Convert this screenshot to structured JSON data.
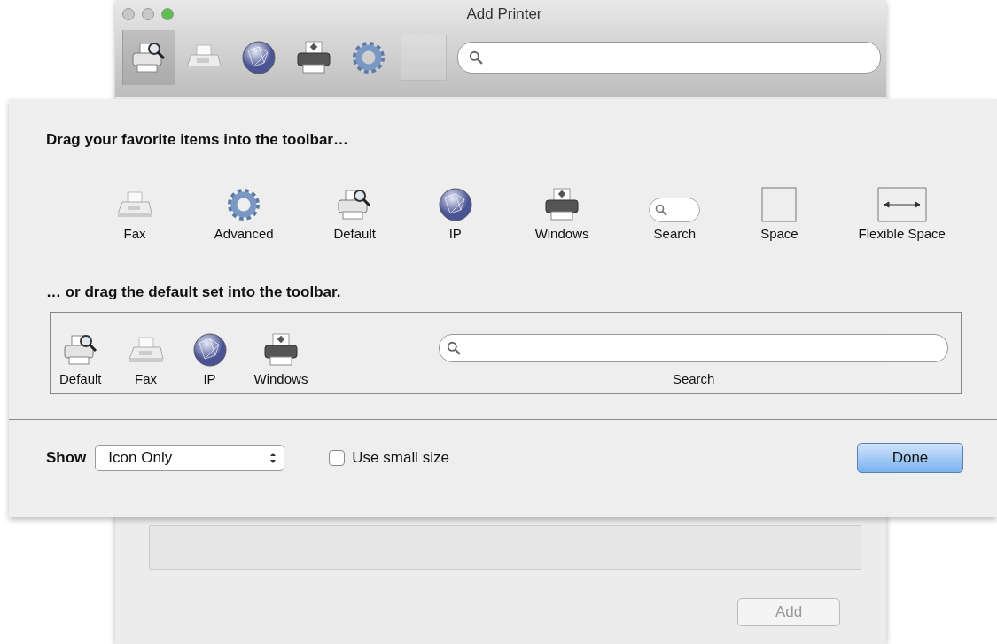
{
  "window": {
    "title": "Add Printer"
  },
  "toolbar": {
    "items": [
      {
        "kind": "default",
        "selected": true
      },
      {
        "kind": "fax",
        "selected": false
      },
      {
        "kind": "ip",
        "selected": false
      },
      {
        "kind": "windows",
        "selected": false
      },
      {
        "kind": "advanced",
        "selected": false
      }
    ]
  },
  "sheet": {
    "palette_heading": "Drag your favorite items into the toolbar…",
    "palette": [
      {
        "kind": "fax",
        "label": "Fax"
      },
      {
        "kind": "advanced",
        "label": "Advanced"
      },
      {
        "kind": "default",
        "label": "Default"
      },
      {
        "kind": "ip",
        "label": "IP"
      },
      {
        "kind": "windows",
        "label": "Windows"
      },
      {
        "kind": "search",
        "label": "Search"
      },
      {
        "kind": "space",
        "label": "Space"
      },
      {
        "kind": "flexible-space",
        "label": "Flexible Space"
      }
    ],
    "default_heading": "… or drag the default set into the toolbar.",
    "default_set": [
      {
        "kind": "default",
        "label": "Default"
      },
      {
        "kind": "fax",
        "label": "Fax"
      },
      {
        "kind": "ip",
        "label": "IP"
      },
      {
        "kind": "windows",
        "label": "Windows"
      },
      {
        "kind": "search-wide",
        "label": "Search"
      }
    ],
    "show_label": "Show",
    "show_value": "Icon Only",
    "small_size": {
      "label": "Use small size",
      "checked": false
    },
    "done": "Done"
  },
  "footer": {
    "add": "Add"
  }
}
